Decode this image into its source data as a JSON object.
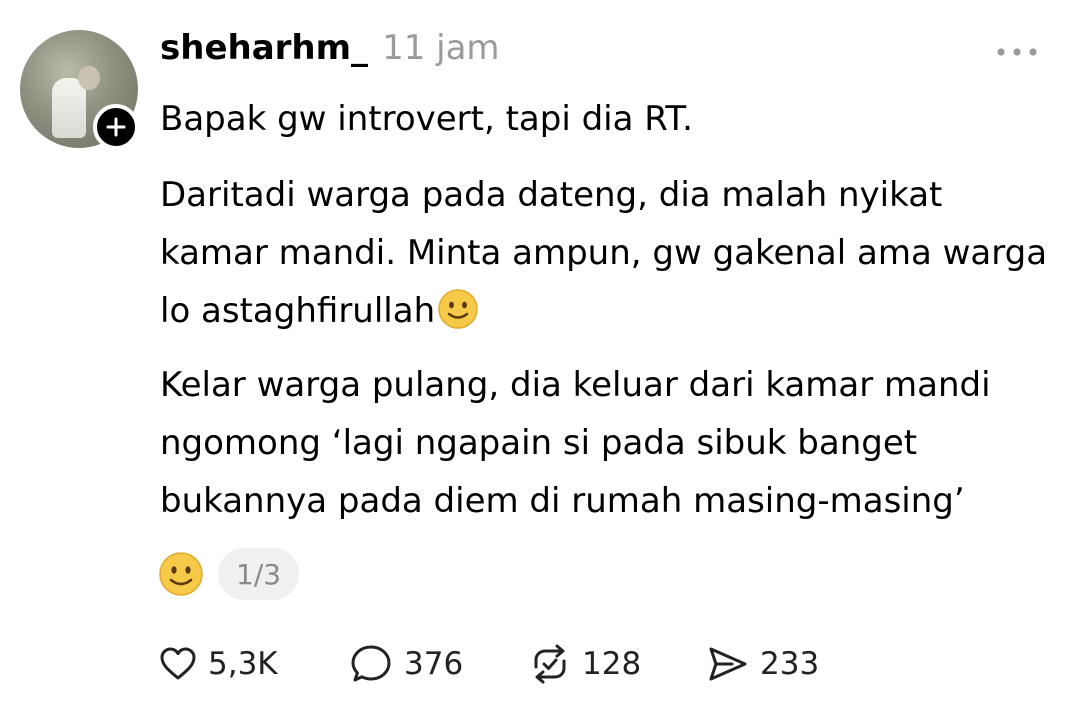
{
  "post": {
    "username": "sheharhm_",
    "timestamp": "11 jam",
    "paragraphs": [
      "Bapak gw introvert, tapi dia RT.",
      "Daritadi warga pada dateng, dia malah nyikat kamar mandi. Minta ampun, gw gakenal ama warga lo astaghfirullah",
      "Kelar warga pulang, dia keluar dari kamar mandi ngomong ‘lagi ngapain si pada sibuk banget bukannya pada diem di rumah masing-masing’"
    ],
    "inline_emoji": "slightly-smiling-face",
    "page_indicator": "1/3"
  },
  "actions": {
    "likes": "5,3K",
    "replies": "376",
    "reposts": "128",
    "shares": "233"
  },
  "icons": {
    "like": "heart-icon",
    "reply": "speech-bubble-icon",
    "repost": "repost-arrows-icon",
    "share": "send-icon",
    "more": "more-horizontal-icon",
    "follow": "plus-icon",
    "reaction": "slightly-smiling-face-icon"
  },
  "colors": {
    "text": "#000000",
    "muted": "#9a9a9a",
    "pill_bg": "#f0f0f0",
    "emoji_yellow": "#f7c948"
  }
}
